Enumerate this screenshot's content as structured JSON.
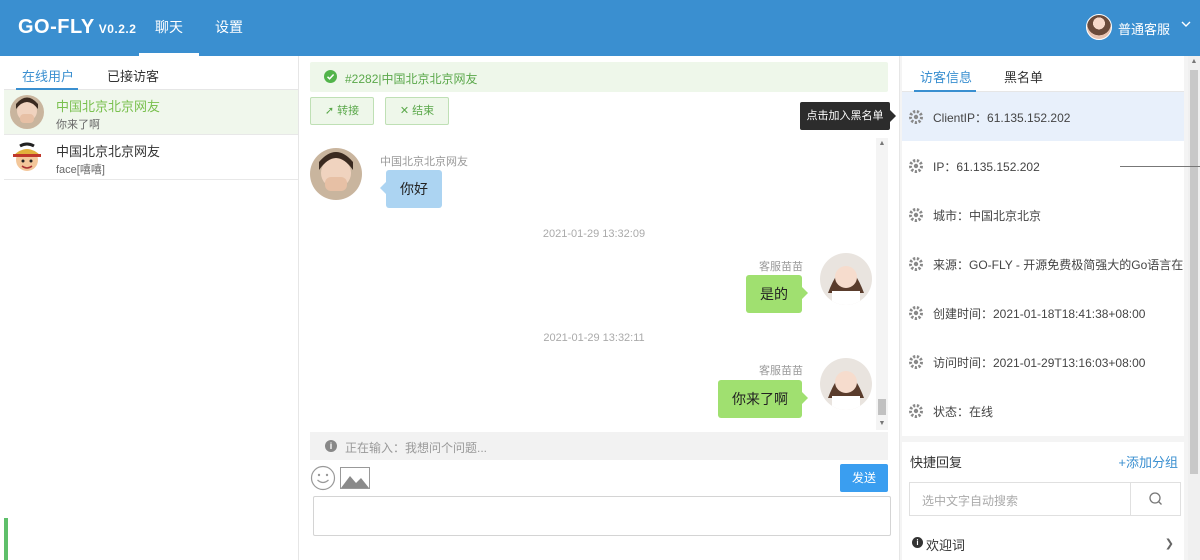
{
  "header": {
    "logo": "GO-FLY",
    "version": "V0.2.2",
    "nav": [
      "聊天",
      "设置"
    ],
    "user_name": "普通客服"
  },
  "left": {
    "tabs": [
      "在线用户",
      "已接访客"
    ],
    "visitors": [
      {
        "name": "中国北京北京网友",
        "last_msg": "你来了啊"
      },
      {
        "name": "中国北京北京网友",
        "last_msg": "face[嘻嘻]"
      }
    ]
  },
  "chat": {
    "header_title": "#2282|中国北京北京网友",
    "buttons": {
      "transfer": "转接",
      "end": "结束"
    },
    "messages": [
      {
        "side": "in",
        "sender": "中国北京北京网友",
        "text": "你好"
      },
      {
        "timestamp": "2021-01-29 13:32:09"
      },
      {
        "side": "out",
        "sender": "客服苗苗",
        "text": "是的"
      },
      {
        "timestamp": "2021-01-29 13:32:11"
      },
      {
        "side": "out",
        "sender": "客服苗苗",
        "text": "你来了啊"
      }
    ],
    "typing_text": "正在输入：我想问个问题...",
    "send_label": "发送"
  },
  "right": {
    "tabs": [
      "访客信息",
      "黑名单"
    ],
    "tooltip": "点击加入黑名单",
    "info": [
      "ClientIP：61.135.152.202",
      "IP：61.135.152.202",
      "城市：中国北京北京",
      "来源：GO-FLY - 开源免费极简强大的Go语言在线",
      "创建时间：2021-01-18T18:41:38+08:00",
      "访问时间：2021-01-29T13:16:03+08:00",
      "状态：在线"
    ],
    "quick_reply": {
      "title": "快捷回复",
      "add_group": "+添加分组",
      "search_placeholder": "选中文字自动搜索",
      "items": [
        "欢迎词"
      ]
    }
  }
}
